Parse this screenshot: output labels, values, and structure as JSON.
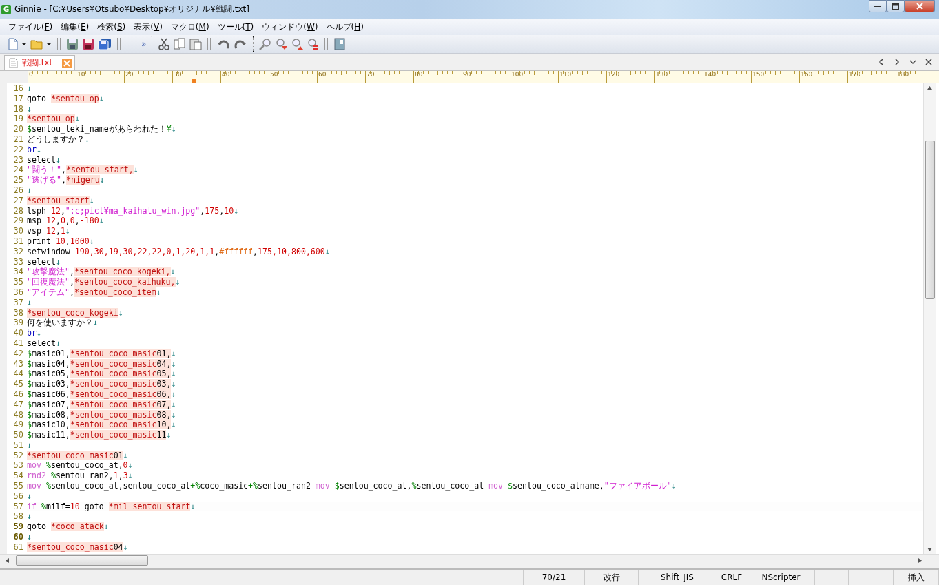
{
  "window": {
    "icon_letter": "G",
    "title": "Ginnie - [C:¥Users¥Otsubo¥Desktop¥オリジナル¥戦闘.txt]"
  },
  "menu": [
    "ファイル(F)",
    "編集(E)",
    "検索(S)",
    "表示(V)",
    "マクロ(M)",
    "ツール(T)",
    "ウィンドウ(W)",
    "ヘルプ(H)"
  ],
  "toolbar": {
    "overflow": "»"
  },
  "tabs": [
    {
      "label": "戦闘.txt",
      "selected": true
    }
  ],
  "ruler": [
    "0",
    "10",
    "20",
    "30",
    "40",
    "50",
    "60",
    "70",
    "80",
    "90",
    "100",
    "110",
    "120",
    "130",
    "140",
    "150",
    "160",
    "170",
    "180"
  ],
  "editor": {
    "lines": [
      {
        "number": "16",
        "current": false,
        "marked": false,
        "tokens": [
          {
            "kind": "eol",
            "text": "↓"
          }
        ]
      },
      {
        "number": "17",
        "current": false,
        "marked": false,
        "tokens": [
          {
            "kind": "text",
            "text": "goto "
          },
          {
            "kind": "label",
            "text": "*sentou_op"
          },
          {
            "kind": "eol",
            "text": "↓"
          }
        ]
      },
      {
        "number": "18",
        "current": false,
        "marked": false,
        "tokens": [
          {
            "kind": "eol",
            "text": "↓"
          }
        ]
      },
      {
        "number": "19",
        "current": false,
        "marked": false,
        "tokens": [
          {
            "kind": "label",
            "text": "*sentou_op"
          },
          {
            "kind": "eol",
            "text": "↓"
          }
        ]
      },
      {
        "number": "20",
        "current": false,
        "marked": false,
        "tokens": [
          {
            "kind": "variable",
            "text": "$"
          },
          {
            "kind": "text",
            "text": "sentou_teki_nameがあらわれた！"
          },
          {
            "kind": "variable",
            "text": "¥"
          },
          {
            "kind": "eol",
            "text": "↓"
          }
        ]
      },
      {
        "number": "21",
        "current": false,
        "marked": false,
        "tokens": [
          {
            "kind": "text",
            "text": "どうしますか？"
          },
          {
            "kind": "eol",
            "text": "↓"
          }
        ]
      },
      {
        "number": "22",
        "current": false,
        "marked": false,
        "tokens": [
          {
            "kind": "builtin",
            "text": "br"
          },
          {
            "kind": "eol",
            "text": "↓"
          }
        ]
      },
      {
        "number": "23",
        "current": false,
        "marked": false,
        "tokens": [
          {
            "kind": "text",
            "text": "select"
          },
          {
            "kind": "eol",
            "text": "↓"
          }
        ]
      },
      {
        "number": "24",
        "current": false,
        "marked": false,
        "tokens": [
          {
            "kind": "string",
            "text": "\"闘う！\""
          },
          {
            "kind": "text",
            "text": ","
          },
          {
            "kind": "label",
            "text": "*sentou_start,"
          },
          {
            "kind": "eol",
            "text": "↓"
          }
        ]
      },
      {
        "number": "25",
        "current": false,
        "marked": false,
        "tokens": [
          {
            "kind": "string",
            "text": "\"逃げる\""
          },
          {
            "kind": "text",
            "text": ","
          },
          {
            "kind": "label",
            "text": "*nigeru"
          },
          {
            "kind": "eol",
            "text": "↓"
          }
        ]
      },
      {
        "number": "26",
        "current": false,
        "marked": false,
        "tokens": [
          {
            "kind": "eol",
            "text": "↓"
          }
        ]
      },
      {
        "number": "27",
        "current": false,
        "marked": false,
        "tokens": [
          {
            "kind": "label",
            "text": "*sentou_start"
          },
          {
            "kind": "eol",
            "text": "↓"
          }
        ]
      },
      {
        "number": "28",
        "current": false,
        "marked": false,
        "tokens": [
          {
            "kind": "text",
            "text": "lsph "
          },
          {
            "kind": "number",
            "text": "12"
          },
          {
            "kind": "text",
            "text": ","
          },
          {
            "kind": "string",
            "text": "\":c;pict¥ma_kaihatu_win.jpg\""
          },
          {
            "kind": "text",
            "text": ","
          },
          {
            "kind": "number",
            "text": "175"
          },
          {
            "kind": "text",
            "text": ","
          },
          {
            "kind": "number",
            "text": "10"
          },
          {
            "kind": "eol",
            "text": "↓"
          }
        ]
      },
      {
        "number": "29",
        "current": false,
        "marked": false,
        "tokens": [
          {
            "kind": "text",
            "text": "msp "
          },
          {
            "kind": "number",
            "text": "12"
          },
          {
            "kind": "text",
            "text": ","
          },
          {
            "kind": "number",
            "text": "0"
          },
          {
            "kind": "text",
            "text": ","
          },
          {
            "kind": "number",
            "text": "0"
          },
          {
            "kind": "text",
            "text": ","
          },
          {
            "kind": "number",
            "text": "-180"
          },
          {
            "kind": "eol",
            "text": "↓"
          }
        ]
      },
      {
        "number": "30",
        "current": false,
        "marked": false,
        "tokens": [
          {
            "kind": "text",
            "text": "vsp "
          },
          {
            "kind": "number",
            "text": "12"
          },
          {
            "kind": "text",
            "text": ","
          },
          {
            "kind": "number",
            "text": "1"
          },
          {
            "kind": "eol",
            "text": "↓"
          }
        ]
      },
      {
        "number": "31",
        "current": false,
        "marked": false,
        "tokens": [
          {
            "kind": "text",
            "text": "print "
          },
          {
            "kind": "number",
            "text": "10"
          },
          {
            "kind": "text",
            "text": ","
          },
          {
            "kind": "number",
            "text": "1000"
          },
          {
            "kind": "eol",
            "text": "↓"
          }
        ]
      },
      {
        "number": "32",
        "current": false,
        "marked": false,
        "tokens": [
          {
            "kind": "text",
            "text": "setwindow "
          },
          {
            "kind": "number",
            "text": "190,30,19,30,22,22,0,1,20,1,1"
          },
          {
            "kind": "text",
            "text": ","
          },
          {
            "kind": "color-code",
            "text": "#ffffff"
          },
          {
            "kind": "text",
            "text": ","
          },
          {
            "kind": "number",
            "text": "175,10,800,600"
          },
          {
            "kind": "eol",
            "text": "↓"
          }
        ]
      },
      {
        "number": "33",
        "current": false,
        "marked": false,
        "tokens": [
          {
            "kind": "text",
            "text": "select"
          },
          {
            "kind": "eol",
            "text": "↓"
          }
        ]
      },
      {
        "number": "34",
        "current": false,
        "marked": false,
        "tokens": [
          {
            "kind": "string",
            "text": "\"攻撃魔法\""
          },
          {
            "kind": "text",
            "text": ","
          },
          {
            "kind": "label",
            "text": "*sentou_coco_kogeki,"
          },
          {
            "kind": "eol",
            "text": "↓"
          }
        ]
      },
      {
        "number": "35",
        "current": false,
        "marked": false,
        "tokens": [
          {
            "kind": "string",
            "text": "\"回復魔法\""
          },
          {
            "kind": "text",
            "text": ","
          },
          {
            "kind": "label",
            "text": "*sentou_coco_kaihuku,"
          },
          {
            "kind": "eol",
            "text": "↓"
          }
        ]
      },
      {
        "number": "36",
        "current": false,
        "marked": false,
        "tokens": [
          {
            "kind": "string",
            "text": "\"アイテム\""
          },
          {
            "kind": "text",
            "text": ","
          },
          {
            "kind": "label",
            "text": "*sentou_coco_item"
          },
          {
            "kind": "eol",
            "text": "↓"
          }
        ]
      },
      {
        "number": "37",
        "current": false,
        "marked": false,
        "tokens": [
          {
            "kind": "eol",
            "text": "↓"
          }
        ]
      },
      {
        "number": "38",
        "current": false,
        "marked": false,
        "tokens": [
          {
            "kind": "label",
            "text": "*sentou_coco_kogeki"
          },
          {
            "kind": "eol",
            "text": "↓"
          }
        ]
      },
      {
        "number": "39",
        "current": false,
        "marked": false,
        "tokens": [
          {
            "kind": "text",
            "text": "何を使いますか？"
          },
          {
            "kind": "eol",
            "text": "↓"
          }
        ]
      },
      {
        "number": "40",
        "current": false,
        "marked": false,
        "tokens": [
          {
            "kind": "builtin",
            "text": "br"
          },
          {
            "kind": "eol",
            "text": "↓"
          }
        ]
      },
      {
        "number": "41",
        "current": false,
        "marked": false,
        "tokens": [
          {
            "kind": "text",
            "text": "select"
          },
          {
            "kind": "eol",
            "text": "↓"
          }
        ]
      },
      {
        "number": "42",
        "current": false,
        "marked": false,
        "tokens": [
          {
            "kind": "variable",
            "text": "$"
          },
          {
            "kind": "text",
            "text": "masic01,"
          },
          {
            "kind": "label",
            "text": "*sentou_coco_masic"
          },
          {
            "kind": "label-tail",
            "text": "01,"
          },
          {
            "kind": "eol",
            "text": "↓"
          }
        ]
      },
      {
        "number": "43",
        "current": false,
        "marked": false,
        "tokens": [
          {
            "kind": "variable",
            "text": "$"
          },
          {
            "kind": "text",
            "text": "masic04,"
          },
          {
            "kind": "label",
            "text": "*sentou_coco_masic"
          },
          {
            "kind": "label-tail",
            "text": "04,"
          },
          {
            "kind": "eol",
            "text": "↓"
          }
        ]
      },
      {
        "number": "44",
        "current": false,
        "marked": false,
        "tokens": [
          {
            "kind": "variable",
            "text": "$"
          },
          {
            "kind": "text",
            "text": "masic05,"
          },
          {
            "kind": "label",
            "text": "*sentou_coco_masic"
          },
          {
            "kind": "label-tail",
            "text": "05,"
          },
          {
            "kind": "eol",
            "text": "↓"
          }
        ]
      },
      {
        "number": "45",
        "current": false,
        "marked": false,
        "tokens": [
          {
            "kind": "variable",
            "text": "$"
          },
          {
            "kind": "text",
            "text": "masic03,"
          },
          {
            "kind": "label",
            "text": "*sentou_coco_masic"
          },
          {
            "kind": "label-tail",
            "text": "03,"
          },
          {
            "kind": "eol",
            "text": "↓"
          }
        ]
      },
      {
        "number": "46",
        "current": false,
        "marked": false,
        "tokens": [
          {
            "kind": "variable",
            "text": "$"
          },
          {
            "kind": "text",
            "text": "masic06,"
          },
          {
            "kind": "label",
            "text": "*sentou_coco_masic"
          },
          {
            "kind": "label-tail",
            "text": "06,"
          },
          {
            "kind": "eol",
            "text": "↓"
          }
        ]
      },
      {
        "number": "47",
        "current": false,
        "marked": false,
        "tokens": [
          {
            "kind": "variable",
            "text": "$"
          },
          {
            "kind": "text",
            "text": "masic07,"
          },
          {
            "kind": "label",
            "text": "*sentou_coco_masic"
          },
          {
            "kind": "label-tail",
            "text": "07,"
          },
          {
            "kind": "eol",
            "text": "↓"
          }
        ]
      },
      {
        "number": "48",
        "current": false,
        "marked": false,
        "tokens": [
          {
            "kind": "variable",
            "text": "$"
          },
          {
            "kind": "text",
            "text": "masic08,"
          },
          {
            "kind": "label",
            "text": "*sentou_coco_masic"
          },
          {
            "kind": "label-tail",
            "text": "08,"
          },
          {
            "kind": "eol",
            "text": "↓"
          }
        ]
      },
      {
        "number": "49",
        "current": false,
        "marked": false,
        "tokens": [
          {
            "kind": "variable",
            "text": "$"
          },
          {
            "kind": "text",
            "text": "masic10,"
          },
          {
            "kind": "label",
            "text": "*sentou_coco_masic"
          },
          {
            "kind": "label-tail",
            "text": "10,"
          },
          {
            "kind": "eol",
            "text": "↓"
          }
        ]
      },
      {
        "number": "50",
        "current": false,
        "marked": false,
        "tokens": [
          {
            "kind": "variable",
            "text": "$"
          },
          {
            "kind": "text",
            "text": "masic11,"
          },
          {
            "kind": "label",
            "text": "*sentou_coco_masic"
          },
          {
            "kind": "label-tail",
            "text": "11"
          },
          {
            "kind": "eol",
            "text": "↓"
          }
        ]
      },
      {
        "number": "51",
        "current": false,
        "marked": false,
        "tokens": [
          {
            "kind": "eol",
            "text": "↓"
          }
        ]
      },
      {
        "number": "52",
        "current": false,
        "marked": false,
        "tokens": [
          {
            "kind": "label",
            "text": "*sentou_coco_masic"
          },
          {
            "kind": "label-tail",
            "text": "01"
          },
          {
            "kind": "eol",
            "text": "↓"
          }
        ]
      },
      {
        "number": "53",
        "current": false,
        "marked": false,
        "tokens": [
          {
            "kind": "keyword",
            "text": "mov "
          },
          {
            "kind": "variable",
            "text": "%"
          },
          {
            "kind": "text",
            "text": "sentou_coco_at,"
          },
          {
            "kind": "number",
            "text": "0"
          },
          {
            "kind": "eol",
            "text": "↓"
          }
        ]
      },
      {
        "number": "54",
        "current": false,
        "marked": false,
        "tokens": [
          {
            "kind": "keyword",
            "text": "rnd2 "
          },
          {
            "kind": "variable",
            "text": "%"
          },
          {
            "kind": "text",
            "text": "sentou_ran2,"
          },
          {
            "kind": "number",
            "text": "1"
          },
          {
            "kind": "text",
            "text": ","
          },
          {
            "kind": "number",
            "text": "3"
          },
          {
            "kind": "eol",
            "text": "↓"
          }
        ]
      },
      {
        "number": "55",
        "current": false,
        "marked": false,
        "tokens": [
          {
            "kind": "keyword",
            "text": "mov "
          },
          {
            "kind": "variable",
            "text": "%"
          },
          {
            "kind": "text",
            "text": "sentou_coco_at,sentou_coco_at"
          },
          {
            "kind": "variable",
            "text": "+%"
          },
          {
            "kind": "text",
            "text": "coco_masic"
          },
          {
            "kind": "variable",
            "text": "+%"
          },
          {
            "kind": "text",
            "text": "sentou_ran2 "
          },
          {
            "kind": "keyword",
            "text": "mov "
          },
          {
            "kind": "variable",
            "text": "$"
          },
          {
            "kind": "text",
            "text": "sentou_coco_at,"
          },
          {
            "kind": "variable",
            "text": "%"
          },
          {
            "kind": "text",
            "text": "sentou_coco_at "
          },
          {
            "kind": "keyword",
            "text": "mov "
          },
          {
            "kind": "variable",
            "text": "$"
          },
          {
            "kind": "text",
            "text": "sentou_coco_atname,"
          },
          {
            "kind": "string",
            "text": "\"ファイアボール\""
          },
          {
            "kind": "eol",
            "text": "↓"
          }
        ]
      },
      {
        "number": "56",
        "current": false,
        "marked": false,
        "tokens": [
          {
            "kind": "eol",
            "text": "↓"
          }
        ]
      },
      {
        "number": "57",
        "current": true,
        "marked": false,
        "tokens": [
          {
            "kind": "keyword",
            "text": "if "
          },
          {
            "kind": "variable",
            "text": "%"
          },
          {
            "kind": "text",
            "text": "milf="
          },
          {
            "kind": "number",
            "text": "10"
          },
          {
            "kind": "text",
            "text": " goto "
          },
          {
            "kind": "label",
            "text": "*mil_sentou_start"
          },
          {
            "kind": "eol",
            "text": "↓"
          }
        ]
      },
      {
        "number": "58",
        "current": false,
        "marked": false,
        "tokens": [
          {
            "kind": "eol",
            "text": "↓"
          }
        ]
      },
      {
        "number": "59",
        "current": false,
        "marked": true,
        "tokens": [
          {
            "kind": "text",
            "text": "goto "
          },
          {
            "kind": "label",
            "text": "*coco_atack"
          },
          {
            "kind": "eol",
            "text": "↓"
          }
        ]
      },
      {
        "number": "60",
        "current": false,
        "marked": true,
        "tokens": [
          {
            "kind": "eol",
            "text": "↓"
          }
        ]
      },
      {
        "number": "61",
        "current": false,
        "marked": false,
        "tokens": [
          {
            "kind": "label",
            "text": "*sentou_coco_masic"
          },
          {
            "kind": "label-tail",
            "text": "04"
          },
          {
            "kind": "eol",
            "text": "↓"
          }
        ]
      }
    ]
  },
  "status_bar": {
    "cells": [
      "70/21",
      "改行",
      "Shift_JIS",
      "CRLF",
      "NScripter",
      "挿入"
    ]
  }
}
